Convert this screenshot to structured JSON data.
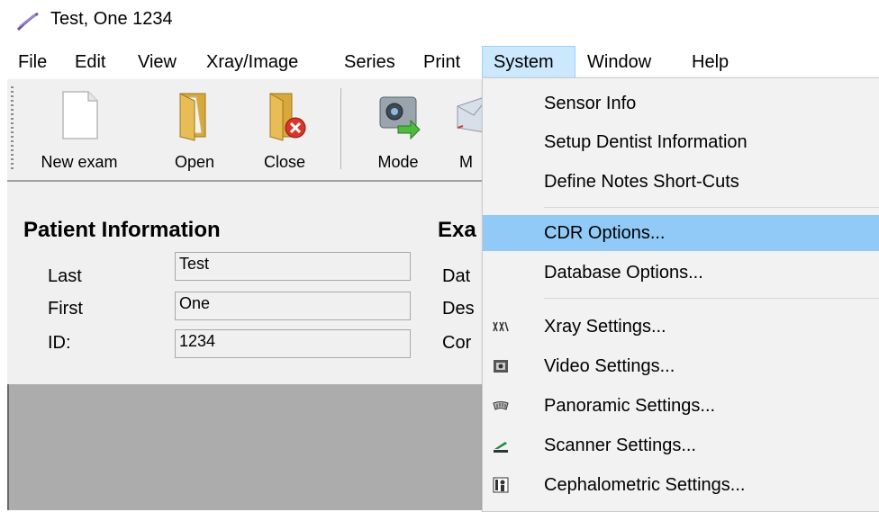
{
  "window": {
    "title": "Test, One 1234"
  },
  "menubar": [
    "File",
    "Edit",
    "View",
    "Xray/Image",
    "Series",
    "Print",
    "System",
    "Window",
    "Help"
  ],
  "toolbar": {
    "new_exam": "New exam",
    "open": "Open",
    "close": "Close",
    "mode": "Mode",
    "partial": "M"
  },
  "patient": {
    "heading": "Patient Information",
    "last_label": "Last",
    "last_value": "Test",
    "first_label": "First",
    "first_value": "One",
    "id_label": "ID:",
    "id_value": "1234"
  },
  "exam": {
    "heading": "Exa",
    "date_label": "Dat",
    "desc_label": "Des",
    "con_label": "Cor"
  },
  "system_menu": {
    "items": [
      "Sensor Info",
      "Setup Dentist Information",
      "Define Notes Short-Cuts",
      "CDR Options...",
      "Database Options...",
      "Xray Settings...",
      "Video Settings...",
      "Panoramic Settings...",
      "Scanner Settings...",
      "Cephalometric Settings..."
    ]
  },
  "colors": {
    "menu_highlight": "#91c9f7",
    "menu_active": "#cce8ff",
    "panel_bg": "#f0f0f0"
  }
}
